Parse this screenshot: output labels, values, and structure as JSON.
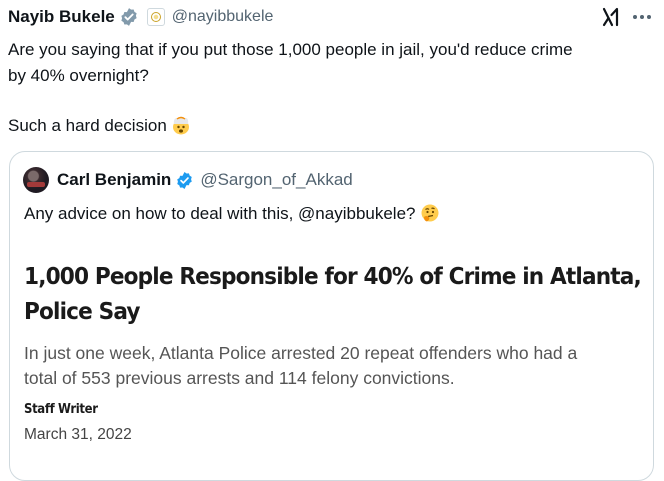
{
  "tweet": {
    "author_name": "Nayib Bukele",
    "author_handle": "@nayibbukele",
    "verified_icon": "verified-badge-icon",
    "affiliate_icon": "affiliate-badge-icon",
    "text_lines": [
      "Are you saying that if you put those 1,000 people in jail, you'd reduce crime",
      "by 40% overnight?"
    ],
    "text_line_2": "Such a hard decision",
    "emoji_1": "exploding-head-emoji",
    "grok_icon": "grok-icon",
    "more_icon": "more-options-icon",
    "colors": {
      "text": "#0f1419",
      "secondary": "#536471",
      "verified_blue": "#1d9bf0",
      "border": "#cfd9de"
    }
  },
  "quote": {
    "author_name": "Carl Benjamin",
    "author_handle": "@Sargon_of_Akkad",
    "text": "Any advice on how to deal with this, @nayibbukele?",
    "emoji": "thinking-face-emoji",
    "article": {
      "headline_lines": [
        "1,000 People Responsible for 40% of Crime in Atlanta,",
        "Police Say"
      ],
      "subheadline_lines": [
        "In just one week, Atlanta Police arrested 20 repeat offenders who had a",
        "total of 553 previous arrests and 114 felony convictions."
      ],
      "byline": "Staff Writer",
      "date": "March 31, 2022"
    }
  }
}
